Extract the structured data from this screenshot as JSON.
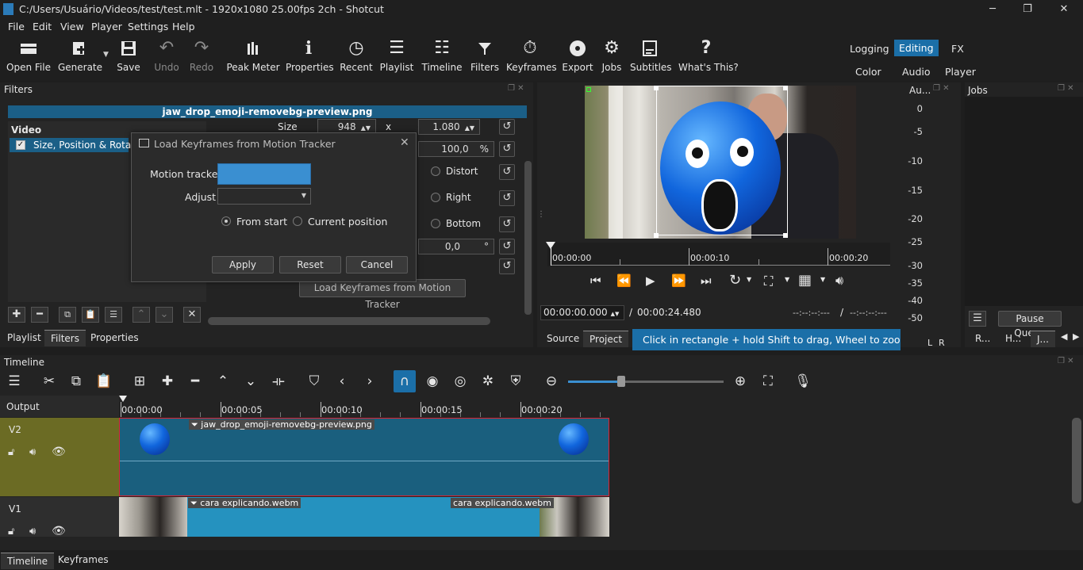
{
  "window": {
    "title": "C:/Users/Usuário/Videos/test/test.mlt - 1920x1080 25.00fps 2ch - Shotcut",
    "minimize": "─",
    "restore": "❐",
    "close": "✕"
  },
  "menu": [
    "File",
    "Edit",
    "View",
    "Player",
    "Settings",
    "Help"
  ],
  "toolbar": {
    "items": [
      {
        "label": "Open File",
        "icon": "folder-icon"
      },
      {
        "label": "Generate",
        "icon": "generate-icon"
      },
      {
        "label": "Save",
        "icon": "save-icon"
      },
      {
        "label": "Undo",
        "icon": "undo-icon"
      },
      {
        "label": "Redo",
        "icon": "redo-icon"
      },
      {
        "label": "Peak Meter",
        "icon": "peak-meter-icon"
      },
      {
        "label": "Properties",
        "icon": "info-icon"
      },
      {
        "label": "Recent",
        "icon": "clock-icon"
      },
      {
        "label": "Playlist",
        "icon": "list-icon"
      },
      {
        "label": "Timeline",
        "icon": "timeline-icon"
      },
      {
        "label": "Filters",
        "icon": "funnel-icon"
      },
      {
        "label": "Keyframes",
        "icon": "stopwatch-icon"
      },
      {
        "label": "Export",
        "icon": "disc-icon"
      },
      {
        "label": "Jobs",
        "icon": "gear-icon"
      },
      {
        "label": "Subtitles",
        "icon": "subtitles-icon"
      },
      {
        "label": "What's This?",
        "icon": "question-icon"
      }
    ],
    "layouts": {
      "logging": "Logging",
      "editing": "Editing",
      "fx": "FX",
      "color": "Color",
      "audio": "Audio",
      "player": "Player"
    }
  },
  "filters": {
    "panel_title": "Filters",
    "clip_name": "jaw_drop_emoji-removebg-preview.png",
    "group": "Video",
    "selected_filter": "Size, Position & Rotate",
    "size_label": "Size",
    "size_w": "948",
    "size_x": "x",
    "size_h": "1.080",
    "zoom": "100,0",
    "zoom_unit": "%",
    "distort": "Distort",
    "right": "Right",
    "bottom": "Bottom",
    "rotation": "0,0",
    "rotation_unit": "°",
    "load_keyframes_button": "Load Keyframes from Motion Tracker"
  },
  "dialog": {
    "title": "Load Keyframes from Motion Tracker",
    "motion_tracker_label": "Motion tracker",
    "adjust_label": "Adjust",
    "from_start": "From start",
    "current_position": "Current position",
    "apply": "Apply",
    "reset": "Reset",
    "cancel": "Cancel",
    "close": "✕"
  },
  "left_tabs": [
    "Playlist",
    "Filters",
    "Properties"
  ],
  "player": {
    "ruler": [
      "00:00:00",
      "00:00:10",
      "00:00:20"
    ],
    "timecode": "00:00:00.000",
    "separator": "/",
    "duration": "00:00:24.480",
    "in_point": "--:--:--:---",
    "out_point": "--:--:--:---",
    "tabs": [
      "Source",
      "Project"
    ],
    "hint": "Click in rectangle + hold Shift to drag, Wheel to zoom, or ..."
  },
  "audio": {
    "title": "Au...",
    "scale": [
      "0",
      "-5",
      "-10",
      "-15",
      "-20",
      "-25",
      "-30",
      "-35",
      "-40",
      "-45",
      "-50"
    ],
    "left": "L",
    "right": "R"
  },
  "jobs": {
    "title": "Jobs",
    "pause_queue": "Pause Queue",
    "tabs": [
      "R...",
      "H...",
      "J..."
    ]
  },
  "timeline": {
    "title": "Timeline",
    "output_label": "Output",
    "ruler": [
      "00:00:00",
      "00:00:05",
      "00:00:10",
      "00:00:15",
      "00:00:20"
    ],
    "tracks": [
      {
        "name": "V2",
        "clip": "jaw_drop_emoji-removebg-preview.png"
      },
      {
        "name": "V1",
        "clip": "cara explicando.webm",
        "clip_end_label": "cara explicando.webm"
      }
    ]
  },
  "bottom_tabs": [
    "Timeline",
    "Keyframes"
  ],
  "colors": {
    "accent": "#1b6fa8",
    "selection": "#1b5f87",
    "v2_track_head": "#6b6b24",
    "clip_blue": "#1f7fae",
    "motion_tracker_field": "#3a8fd1"
  }
}
